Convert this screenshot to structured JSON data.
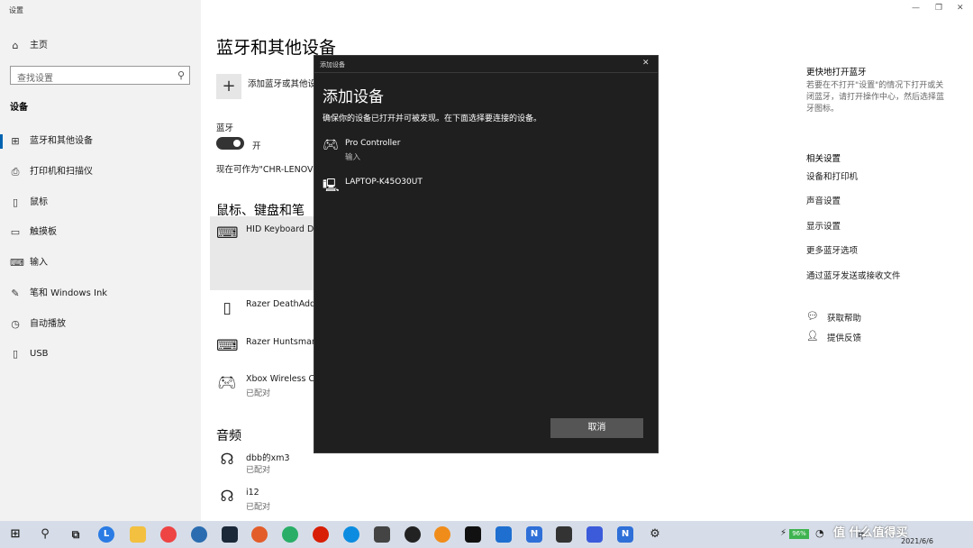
{
  "window": {
    "title": "设置",
    "controls": {
      "minimize": "—",
      "restore": "❐",
      "close": "✕"
    }
  },
  "sidebar": {
    "home": "主页",
    "search_placeholder": "查找设置",
    "section": "设备",
    "items": [
      {
        "label": "蓝牙和其他设备",
        "icon": "bluetooth-devices-icon",
        "glyph": "⊞"
      },
      {
        "label": "打印机和扫描仪",
        "icon": "printer-icon",
        "glyph": "⎙"
      },
      {
        "label": "鼠标",
        "icon": "mouse-icon",
        "glyph": "▯"
      },
      {
        "label": "触摸板",
        "icon": "touchpad-icon",
        "glyph": "▭"
      },
      {
        "label": "输入",
        "icon": "keyboard-icon",
        "glyph": "⌨"
      },
      {
        "label": "笔和 Windows Ink",
        "icon": "pen-icon",
        "glyph": "✎"
      },
      {
        "label": "自动播放",
        "icon": "autoplay-icon",
        "glyph": "◷"
      },
      {
        "label": "USB",
        "icon": "usb-icon",
        "glyph": "▯"
      }
    ]
  },
  "main": {
    "title": "蓝牙和其他设备",
    "add_device": "添加蓝牙或其他设",
    "bluetooth_heading": "蓝牙",
    "bluetooth_state": "开",
    "discoverable": "现在可作为\"CHR-LENOVO",
    "input_heading": "鼠标、键盘和笔",
    "devices": [
      {
        "name": "HID Keyboard De",
        "status": ""
      },
      {
        "name": "Razer DeathAdde",
        "status": ""
      },
      {
        "name": "Razer Huntsman T",
        "status": ""
      },
      {
        "name": "Xbox Wireless Co",
        "status": "已配对"
      }
    ],
    "audio_heading": "音频",
    "audio_devices": [
      {
        "name": "dbb的xm3",
        "status": "已配对"
      },
      {
        "name": "i12",
        "status": "已配对"
      }
    ]
  },
  "right": {
    "tip_heading": "更快地打开蓝牙",
    "tip_text": [
      "若要在不打开\"设置\"的情况下打开或关",
      "闭蓝牙，请打开操作中心，然后选择蓝",
      "牙图标。"
    ],
    "related_heading": "相关设置",
    "related_links": [
      "设备和打印机",
      "声音设置",
      "显示设置",
      "更多蓝牙选项",
      "通过蓝牙发送或接收文件"
    ],
    "help": "获取帮助",
    "feedback": "提供反馈"
  },
  "dialog": {
    "window_title": "添加设备",
    "close": "✕",
    "title": "添加设备",
    "instruction": "确保你的设备已打开并可被发现。在下面选择要连接的设备。",
    "devices": [
      {
        "name": "Pro Controller",
        "type": "输入"
      },
      {
        "name": "LAPTOP-K45O30UT",
        "type": ""
      }
    ],
    "cancel": "取消"
  },
  "taskbar": {
    "battery": "96%",
    "date": "2021/6/6",
    "ime": "中",
    "watermark": "值 什么值得买"
  }
}
